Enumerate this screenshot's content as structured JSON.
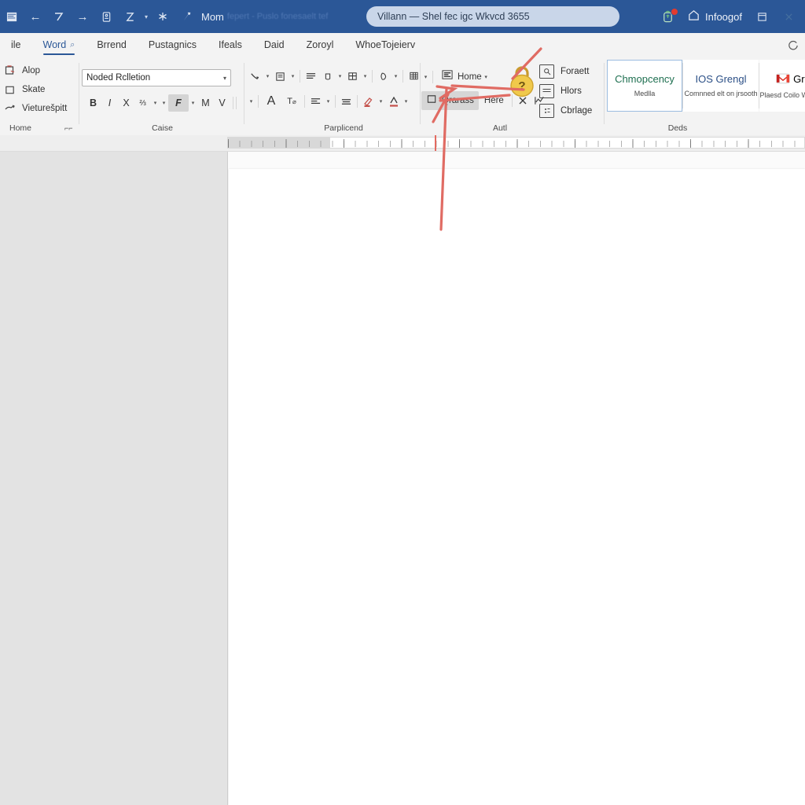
{
  "titlebar": {
    "app_icon": "word-doc-icon",
    "quick_access": [
      {
        "name": "back-arrow-icon",
        "glyph": "←"
      },
      {
        "name": "undo-icon",
        "glyph": "↶"
      },
      {
        "name": "redo-icon",
        "glyph": "→"
      },
      {
        "name": "save-icon",
        "glyph": "▤"
      },
      {
        "name": "autosave-toggle-icon",
        "glyph": "Z"
      },
      {
        "name": "customize-caret-icon",
        "glyph": "▾"
      },
      {
        "name": "accessibility-icon",
        "glyph": "✳"
      },
      {
        "name": "share-up-icon",
        "glyph": "↗"
      }
    ],
    "mode_label": "Mom",
    "ghost_label": "fepert - Puslo fonesaelt tef",
    "document_title": "Villann — Shel fec igc Wkvcd 3655",
    "notify_icon": "bell-alert-icon",
    "account_icon": "account-home-icon",
    "account_label": "Infoogof",
    "restore_icon": "restore-window-icon",
    "close_icon": "close-window-icon"
  },
  "tabs": [
    {
      "label": "ile",
      "active": false,
      "mark": ""
    },
    {
      "label": "Word",
      "active": true,
      "mark": "⌕"
    },
    {
      "label": "Brrend",
      "active": false,
      "mark": ""
    },
    {
      "label": "Pustagnics",
      "active": false,
      "mark": ""
    },
    {
      "label": "Ifeals",
      "active": false,
      "mark": ""
    },
    {
      "label": "Daid",
      "active": false,
      "mark": ""
    },
    {
      "label": "Zoroyl",
      "active": false,
      "mark": ""
    },
    {
      "label": "WhoeTojeierv",
      "active": false,
      "mark": ""
    }
  ],
  "tabstrip_right_icon": "refresh-icon",
  "ribbon": {
    "clipboard_group": {
      "label": "Home",
      "dialog_launcher": "dialog-launcher-icon",
      "commands": [
        {
          "icon": "paste-icon",
          "label": "Alop"
        },
        {
          "icon": "cut-square-icon",
          "label": "Skate"
        },
        {
          "icon": "format-painter-icon",
          "label": "Vieturešpitt"
        }
      ]
    },
    "font_group": {
      "label": "Caise",
      "font_name": "Noded Rclletion",
      "font_caret": "▾",
      "buttons_row1": [
        {
          "name": "bold-button",
          "glyph": "B",
          "selected": false
        },
        {
          "name": "italic-button",
          "glyph": "I",
          "selected": false
        },
        {
          "name": "strikethrough-button",
          "glyph": "X",
          "selected": false
        },
        {
          "name": "subscript-button",
          "glyph": "⅔",
          "selected": false
        },
        {
          "name": "text-effects-caret",
          "glyph": "▾",
          "selected": false
        },
        {
          "name": "highlight-caret",
          "glyph": "▾",
          "selected": false
        },
        {
          "name": "font-color-button",
          "glyph": "F",
          "selected": true
        },
        {
          "name": "font-color-caret",
          "glyph": "▾",
          "selected": false
        },
        {
          "name": "grow-font-button",
          "glyph": "M",
          "selected": false
        },
        {
          "name": "shrink-font-button",
          "glyph": "V",
          "selected": false
        }
      ],
      "buttons_row2": [
        {
          "name": "change-case-button",
          "glyph": "A"
        },
        {
          "name": "clear-formatting-button",
          "glyph": "T"
        }
      ]
    },
    "paragraph_group": {
      "label": "Parplicend",
      "row1": [
        {
          "name": "bullets-button",
          "glyph": "↘"
        },
        {
          "name": "bullets-caret",
          "glyph": "▾"
        },
        {
          "name": "numbering-button",
          "glyph": "▤"
        },
        {
          "name": "numbering-caret",
          "glyph": "▾"
        },
        {
          "name": "align-justify-button",
          "glyph": "≡"
        },
        {
          "name": "line-spacing-button",
          "glyph": "⎕"
        },
        {
          "name": "line-spacing-caret",
          "glyph": "▾"
        },
        {
          "name": "borders-button",
          "glyph": "⊞"
        },
        {
          "name": "borders-caret",
          "glyph": "▾"
        },
        {
          "name": "shading-button",
          "glyph": "◌"
        },
        {
          "name": "shading-caret",
          "glyph": "▾"
        },
        {
          "name": "sort-button",
          "glyph": "▦"
        }
      ],
      "row2": [
        {
          "name": "align-left-button",
          "glyph": "≡"
        },
        {
          "name": "align-left-caret",
          "glyph": "▾"
        },
        {
          "name": "align-center-button",
          "glyph": "≡"
        },
        {
          "name": "highlight-color-button",
          "glyph": "✎"
        },
        {
          "name": "highlight-color-caret",
          "glyph": "▾"
        },
        {
          "name": "text-color-button",
          "glyph": "A"
        },
        {
          "name": "text-color-caret",
          "glyph": "▾"
        }
      ]
    },
    "editing_group": {
      "label": "Autl",
      "dictate_caret": "▾",
      "primary_button": {
        "icon": "text-box-icon",
        "label": "Home",
        "caret": "▾"
      },
      "selected_button": {
        "icon": "frame-icon",
        "label": "Qrarass"
      },
      "second_button": {
        "label": "Here"
      },
      "extra_icons": [
        {
          "name": "close-x-icon",
          "glyph": "✕"
        },
        {
          "name": "trend-chart-icon",
          "glyph": "📈"
        }
      ],
      "mini_list": [
        {
          "icon": "find-icon",
          "label": "Foraett"
        },
        {
          "icon": "replace-icon",
          "label": "Hlors"
        },
        {
          "icon": "select-icon",
          "label": "Cbrlage"
        }
      ]
    },
    "styles_group": {
      "label": "Deds",
      "cards": [
        {
          "title": "Chmopcency",
          "subtitle": "Medlla",
          "selected": true,
          "title_color": "#1e6f50",
          "icon": ""
        },
        {
          "title": "IOS Grengl",
          "subtitle": "Comnned elt on jrsooth",
          "selected": false,
          "title_color": "#2b4f86",
          "icon": ""
        },
        {
          "title": "Gratz",
          "subtitle": "Plaesd Coilo Wilih aene",
          "selected": false,
          "title_color": "#3a3a3a",
          "icon": "mail-icon"
        }
      ]
    }
  },
  "ruler": {
    "cursor_marker": "red-cursor-marker",
    "left_margin_shaded": true
  },
  "annotations": {
    "color": "#e06b63",
    "marks": [
      {
        "name": "arrow-to-textbox-button",
        "type": "arrow"
      },
      {
        "name": "arrow-to-lock-badge",
        "type": "arrow"
      },
      {
        "name": "vertical-pointer-line",
        "type": "line"
      }
    ]
  },
  "lock_badge": {
    "name": "locked-question-badge",
    "glyph": "?",
    "body_color": "#f0c94b",
    "shackle_color": "#c99a2e"
  },
  "document": {
    "page_name": "document-page",
    "content": ""
  }
}
